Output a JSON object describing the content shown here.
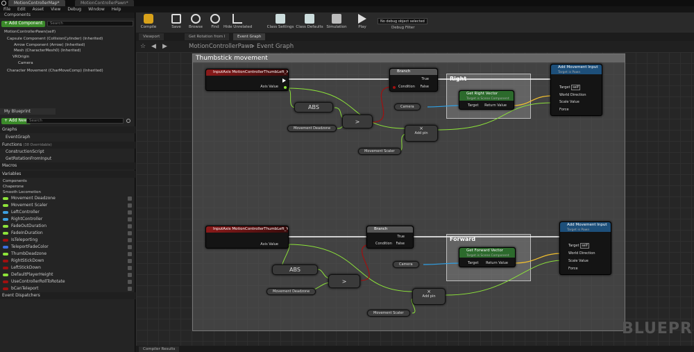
{
  "window": {
    "tabs": [
      "MotionControllerMap*",
      "MotionControllerPawn*"
    ]
  },
  "menu": [
    "File",
    "Edit",
    "Asset",
    "View",
    "Debug",
    "Window",
    "Help"
  ],
  "components_panel": {
    "title": "Components",
    "add_button": "+ Add Component",
    "search_placeholder": "Search",
    "self_item": "MotionControllerPawn(self)",
    "tree": [
      "Capsule Component (CollisionCylinder) (Inherited)",
      "Arrow Component (Arrow) (Inherited)",
      "Mesh (CharacterMesh0) (Inherited)",
      "VROrigin",
      "Camera",
      "Character Movement (CharMoveComp) (Inherited)"
    ]
  },
  "my_blueprint": {
    "tab": "My Blueprint",
    "add_button": "+ Add New",
    "search_placeholder": "Search",
    "graphs_label": "Graphs",
    "event_graph": "EventGraph",
    "functions_label": "Functions",
    "functions_count": "(38 Overridable)",
    "functions": [
      "ConstructionScript",
      "GetRotationFromInput"
    ],
    "macros_label": "Macros",
    "variables_label": "Variables",
    "categories": [
      "Components",
      "Chaperone",
      "Smooth Locomotion"
    ],
    "variables": [
      {
        "name": "Movement Deadzone",
        "color": "#8de33a"
      },
      {
        "name": "Movement Scaler",
        "color": "#8de33a"
      },
      {
        "name": "LeftController",
        "color": "#3d9fe0"
      },
      {
        "name": "RightController",
        "color": "#3d9fe0"
      },
      {
        "name": "FadeOutDuration",
        "color": "#8de33a"
      },
      {
        "name": "FadeInDuration",
        "color": "#8de33a"
      },
      {
        "name": "IsTeleporting",
        "color": "#a01010"
      },
      {
        "name": "TeleportFadeColor",
        "color": "#3d70e0"
      },
      {
        "name": "ThumbDeadzone",
        "color": "#8de33a"
      },
      {
        "name": "RightStickDown",
        "color": "#a01010"
      },
      {
        "name": "LeftStickDown",
        "color": "#a01010"
      },
      {
        "name": "DefaultPlayerHeight",
        "color": "#8de33a"
      },
      {
        "name": "UseControllerRollToRotate",
        "color": "#a01010"
      },
      {
        "name": "bCanTeleport",
        "color": "#a01010"
      }
    ],
    "dispatchers_label": "Event Dispatchers"
  },
  "toolbar": {
    "compile": "Compile",
    "save": "Save",
    "browse": "Browse",
    "find": "Find",
    "hide_unrelated": "Hide Unrelated",
    "class_settings": "Class Settings",
    "class_defaults": "Class Defaults",
    "simulation": "Simulation",
    "play": "Play",
    "debug_select": "No debug object selected",
    "debug_filter": "Debug Filter"
  },
  "doc_tabs": [
    "Viewport",
    "Get Rotation from I",
    "Event Graph"
  ],
  "breadcrumb": {
    "root": "MotionControllerPawn",
    "sep": ">",
    "current": "Event Graph"
  },
  "graph": {
    "comment_title": "Thumbstick movement",
    "right_label": "Right",
    "forward_label": "Forward",
    "input_x": "InputAxis MotionControllerThumbLeft_X",
    "input_y": "InputAxis MotionControllerThumbLeft_Y",
    "axis_value": "Axis Value",
    "branch": "Branch",
    "condition": "Condition",
    "true_label": "True",
    "false_label": "False",
    "abs": "ABS",
    "greater": ">",
    "multiply": "×",
    "add_pin": "Add pin",
    "movement_deadzone": "Movement Deadzone",
    "movement_scaler": "Movement Scaler",
    "camera": "Camera",
    "get_right_vector": "Get Right Vector",
    "get_forward_vector": "Get Forward Vector",
    "target_scene": "Target is Scene Component",
    "target": "Target",
    "return_value": "Return Value",
    "add_movement_input": "Add Movement Input",
    "target_pawn": "Target is Pawn",
    "self": "self",
    "world_direction": "World Direction",
    "scale_value": "Scale Value",
    "force": "Force",
    "watermark": "BLUEPR"
  },
  "bottom": {
    "compiler_results": "Compiler Results"
  },
  "colors": {
    "event_header": "#8b1a1a",
    "function_header": "#1d4f7a",
    "pure_header": "#2c6a2c",
    "float_pin": "#8de33a",
    "object_pin": "#2fa0e5",
    "vector_pin": "#f2c02e",
    "bool_pin": "#a01010"
  }
}
